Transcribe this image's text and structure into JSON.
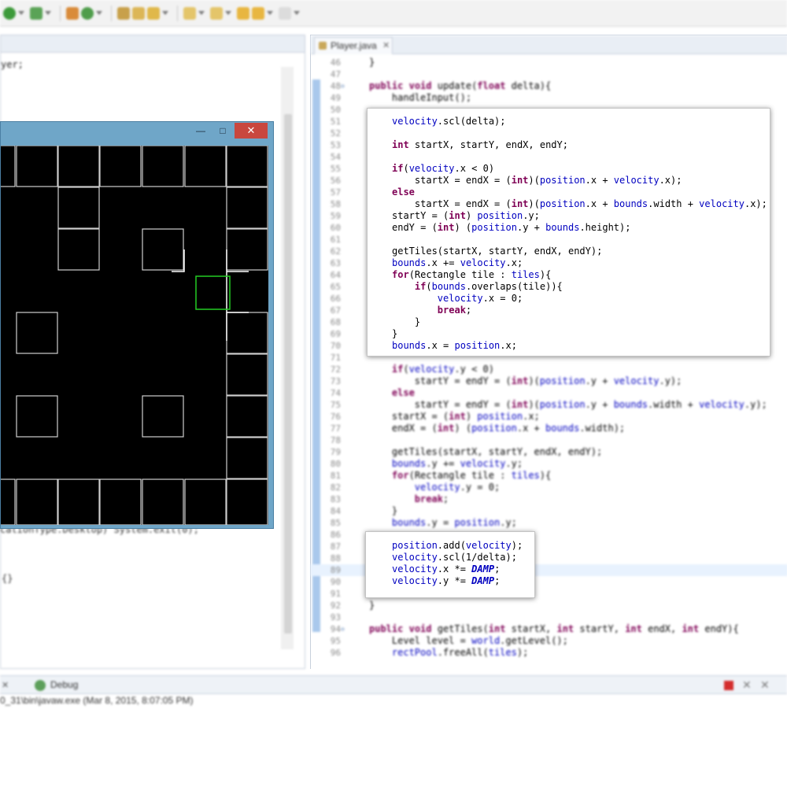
{
  "left_panel": {
    "code_fragment": "yer;",
    "fragment_1": "cationType.Desktop) System.exit(0);",
    "fragment_2": "{}"
  },
  "game_window": {
    "minimize_glyph": "—",
    "maximize_glyph": "□",
    "close_glyph": "✕"
  },
  "editor": {
    "tab_label": "Player.java",
    "tab_close_glyph": "✕",
    "lines": [
      {
        "n": 46,
        "text": "    }"
      },
      {
        "n": 47,
        "text": ""
      },
      {
        "n": 48,
        "text": "    public void update(float delta){",
        "fold": true
      },
      {
        "n": 49,
        "text": "        handleInput();"
      },
      {
        "n": 50,
        "text": ""
      },
      {
        "n": 51,
        "text": "        velocity.scl(delta);"
      },
      {
        "n": 52,
        "text": ""
      },
      {
        "n": 53,
        "text": "        int startX, startY, endX, endY;"
      },
      {
        "n": 54,
        "text": ""
      },
      {
        "n": 55,
        "text": "        if(velocity.x < 0)"
      },
      {
        "n": 56,
        "text": "            startX = endX = (int)(position.x + velocity.x);"
      },
      {
        "n": 57,
        "text": "        else"
      },
      {
        "n": 58,
        "text": "            startX = endX = (int)(position.x + bounds.width + velocity.x);"
      },
      {
        "n": 59,
        "text": "        startY = (int) position.y;"
      },
      {
        "n": 60,
        "text": "        endY = (int) (position.y + bounds.height);"
      },
      {
        "n": 61,
        "text": ""
      },
      {
        "n": 62,
        "text": "        getTiles(startX, startY, endX, endY);"
      },
      {
        "n": 63,
        "text": "        bounds.x += velocity.x;"
      },
      {
        "n": 64,
        "text": "        for(Rectangle tile : tiles){"
      },
      {
        "n": 65,
        "text": "            if(bounds.overlaps(tile)){"
      },
      {
        "n": 66,
        "text": "                velocity.x = 0;"
      },
      {
        "n": 67,
        "text": "                break;"
      },
      {
        "n": 68,
        "text": "            }"
      },
      {
        "n": 69,
        "text": "        }"
      },
      {
        "n": 70,
        "text": "        bounds.x = position.x;"
      },
      {
        "n": 71,
        "text": ""
      },
      {
        "n": 72,
        "text": "        if(velocity.y < 0)"
      },
      {
        "n": 73,
        "text": "            startY = endY = (int)(position.y + velocity.y);"
      },
      {
        "n": 74,
        "text": "        else"
      },
      {
        "n": 75,
        "text": "            startY = endY = (int)(position.y + bounds.width + velocity.y);"
      },
      {
        "n": 76,
        "text": "        startX = (int) position.x;"
      },
      {
        "n": 77,
        "text": "        endX = (int) (position.x + bounds.width);"
      },
      {
        "n": 78,
        "text": ""
      },
      {
        "n": 79,
        "text": "        getTiles(startX, startY, endX, endY);"
      },
      {
        "n": 80,
        "text": "        bounds.y += velocity.y;"
      },
      {
        "n": 81,
        "text": "        for(Rectangle tile : tiles){"
      },
      {
        "n": 82,
        "text": "            velocity.y = 0;"
      },
      {
        "n": 83,
        "text": "            break;"
      },
      {
        "n": 84,
        "text": "        }"
      },
      {
        "n": 85,
        "text": "        bounds.y = position.y;"
      },
      {
        "n": 86,
        "text": ""
      },
      {
        "n": 87,
        "text": "        position.add(velocity);"
      },
      {
        "n": 88,
        "text": "        velocity.scl(1/delta);"
      },
      {
        "n": 89,
        "text": "        velocity.x *= DAMP;"
      },
      {
        "n": 90,
        "text": "        velocity.y *= DAMP;"
      },
      {
        "n": 91,
        "text": ""
      },
      {
        "n": 92,
        "text": "    }"
      },
      {
        "n": 93,
        "text": ""
      },
      {
        "n": 94,
        "text": "    public void getTiles(int startX, int startY, int endX, int endY){",
        "fold": true
      },
      {
        "n": 95,
        "text": "        Level level = world.getLevel();"
      },
      {
        "n": 96,
        "text": "        rectPool.freeAll(tiles);"
      }
    ]
  },
  "popup_top": {
    "lines": [
      "velocity.scl(delta);",
      "",
      "int startX, startY, endX, endY;",
      "",
      "if(velocity.x < 0)",
      "    startX = endX = (int)(position.x + velocity.x);",
      "else",
      "    startX = endX = (int)(position.x + bounds.width + velocity.x);",
      "startY = (int) position.y;",
      "endY = (int) (position.y + bounds.height);",
      "",
      "getTiles(startX, startY, endX, endY);",
      "bounds.x += velocity.x;",
      "for(Rectangle tile : tiles){",
      "    if(bounds.overlaps(tile)){",
      "        velocity.x = 0;",
      "        break;",
      "    }",
      "}",
      "bounds.x = position.x;"
    ]
  },
  "popup_bottom": {
    "lines": [
      "position.add(velocity);",
      "velocity.scl(1/delta);",
      "velocity.x *= DAMP;",
      "velocity.y *= DAMP;"
    ]
  },
  "console": {
    "tab_close_glyph": "✕",
    "debug_tab_label": "Debug",
    "status_text": "0_31\\bin\\javaw.exe (Mar 8, 2015, 8:07:05 PM)",
    "remove_glyph": "✕",
    "remove_all_glyph": "✕"
  },
  "colors": {
    "keyword": "#7f0055",
    "field": "#0000c0",
    "player_box": "#22cc22",
    "grid_line": "#cfcfcf"
  }
}
